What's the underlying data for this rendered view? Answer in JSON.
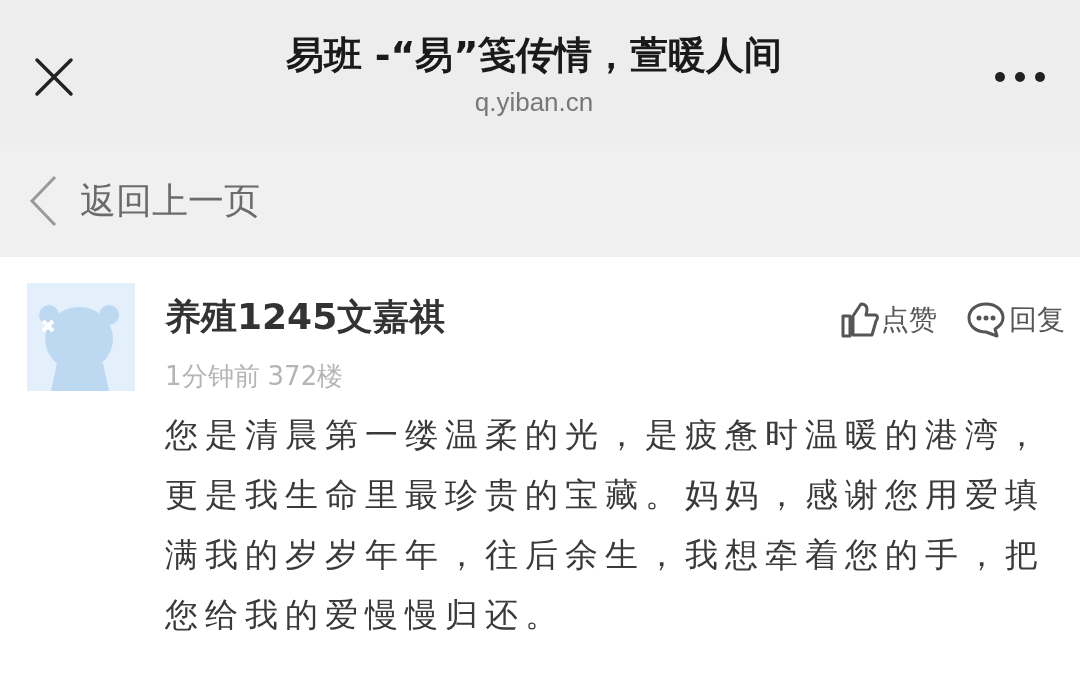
{
  "header": {
    "title": "易班 -“易”笺传情，萱暖人间",
    "url": "q.yiban.cn"
  },
  "back": {
    "label": "返回上一页"
  },
  "comment": {
    "author": "养殖1245文嘉祺",
    "time": "1分钟前",
    "floor": "372楼",
    "like": "点赞",
    "reply": "回复",
    "text": "您是清晨第一缕温柔的光，是疲惫时温暖的港湾，更是我生命里最珍贵的宝藏。妈妈，感谢您用爱填满我的岁岁年年，往后余生，我想牵着您的手，把您给我的爱慢慢归还。"
  }
}
